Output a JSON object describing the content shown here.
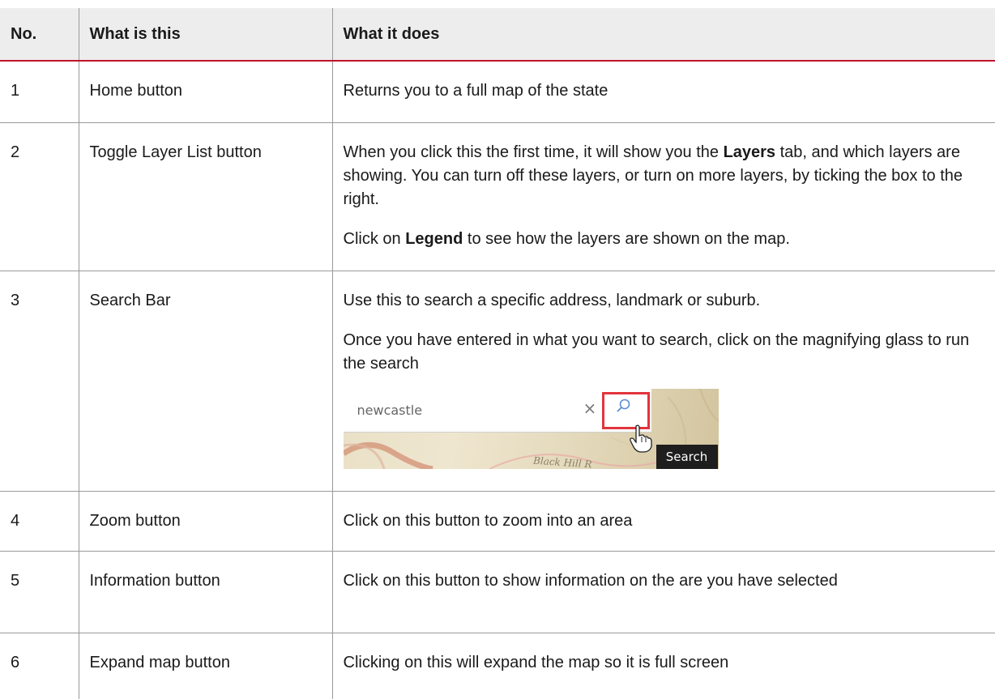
{
  "table": {
    "headers": [
      "No.",
      "What is this",
      "What it does"
    ],
    "rows": [
      {
        "no": "1",
        "what": "Home button",
        "does": "Returns you to a full map of the state"
      },
      {
        "no": "2",
        "what": "Toggle Layer List button",
        "does_p1_a": "When you click this the first time, it will show you the ",
        "does_p1_b": "Layers",
        "does_p1_c": " tab, and which layers are showing. You can turn off these layers, or turn on more layers, by ticking the box to the right.",
        "does_p2_a": "Click on ",
        "does_p2_b": "Legend",
        "does_p2_c": " to see how the layers are shown on the map."
      },
      {
        "no": "3",
        "what": "Search Bar",
        "does_p1": "Use this to search a specific address, landmark or suburb.",
        "does_p2": "Once you have entered in what you want to search, click on the magnifying glass to run the search",
        "screenshot": {
          "input_text": "newcastle",
          "clear_glyph": "×",
          "tooltip": "Search",
          "map_label": "Black Hill R"
        }
      },
      {
        "no": "4",
        "what": "Zoom button",
        "does": "Click on this button to zoom into an area"
      },
      {
        "no": "5",
        "what": "Information button",
        "does": "Click on this button to show information on the are you have selected"
      },
      {
        "no": "6",
        "what": "Expand map button",
        "does": "Clicking on this will expand the map so it is full screen"
      }
    ]
  },
  "colors": {
    "header_bg": "#ededed",
    "header_rule": "#c0142e",
    "grid": "#9a9a9a",
    "highlight": "#e2343d"
  }
}
